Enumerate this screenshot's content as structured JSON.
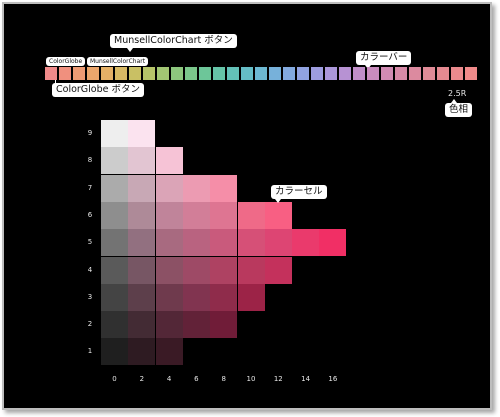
{
  "callouts": {
    "munsell_chart_button": "MunsellColorChart ボタン",
    "color_bar": "カラーバー",
    "color_globe_button": "ColorGlobe ボタン",
    "hue_label": "色相",
    "color_cell": "カラーセル"
  },
  "buttons": {
    "color_globe": "ColorGlobe",
    "munsell_chart": "MunsellColorChart"
  },
  "hue": {
    "value": "2.5R"
  },
  "color_bar": {
    "colors": [
      "#f08a8a",
      "#f0907e",
      "#ee9b74",
      "#eba66c",
      "#e4b066",
      "#d8b964",
      "#c9c064",
      "#b6c469",
      "#a2c673",
      "#8dc77e",
      "#7bc78b",
      "#6dc699",
      "#66c4a8",
      "#63c1b8",
      "#65bdc6",
      "#6cb8d2",
      "#77b1da",
      "#83aadf",
      "#91a3e1",
      "#9e9ddf",
      "#ab97da",
      "#b792d3",
      "#c18ec9",
      "#ca8cbe",
      "#d18bb3",
      "#d78aa8",
      "#dc8a9f",
      "#e08b97",
      "#e58a91",
      "#ea8a8d",
      "#f08a8a"
    ]
  },
  "chart": {
    "value_labels": [
      "9",
      "8",
      "7",
      "6",
      "5",
      "4",
      "3",
      "2",
      "1"
    ],
    "chroma_labels": [
      "0",
      "2",
      "4",
      "6",
      "8",
      "10",
      "12",
      "14",
      "16"
    ],
    "rows": [
      [
        "#eeeeee",
        "#fbe3ef"
      ],
      [
        "#cccccc",
        "#e2c5d2",
        "#f6c3d6"
      ],
      [
        "#ababab",
        "#c8a8b5",
        "#dba4b7",
        "#ec9bb2",
        "#f58ea8"
      ],
      [
        "#8e8e8e",
        "#ae8a98",
        "#c0849a",
        "#d27e98",
        "#de7592",
        "#ef6a88",
        "#f85f83"
      ],
      [
        "#737373",
        "#927080",
        "#a86a80",
        "#b96380",
        "#c95a7c",
        "#d65077",
        "#dd4573",
        "#ea3a6c",
        "#f12f65"
      ],
      [
        "#5a5a5a",
        "#775664",
        "#8c5165",
        "#9e4a66",
        "#ae4262",
        "#b9395e",
        "#c4315c"
      ],
      [
        "#444444",
        "#5d3f4b",
        "#6f3a4d",
        "#813450",
        "#8f2c4b",
        "#9c2347"
      ],
      [
        "#303030",
        "#432b34",
        "#532737",
        "#622238",
        "#701c38"
      ],
      [
        "#1f1f1f",
        "#2e1b22",
        "#3a1a25"
      ]
    ]
  }
}
